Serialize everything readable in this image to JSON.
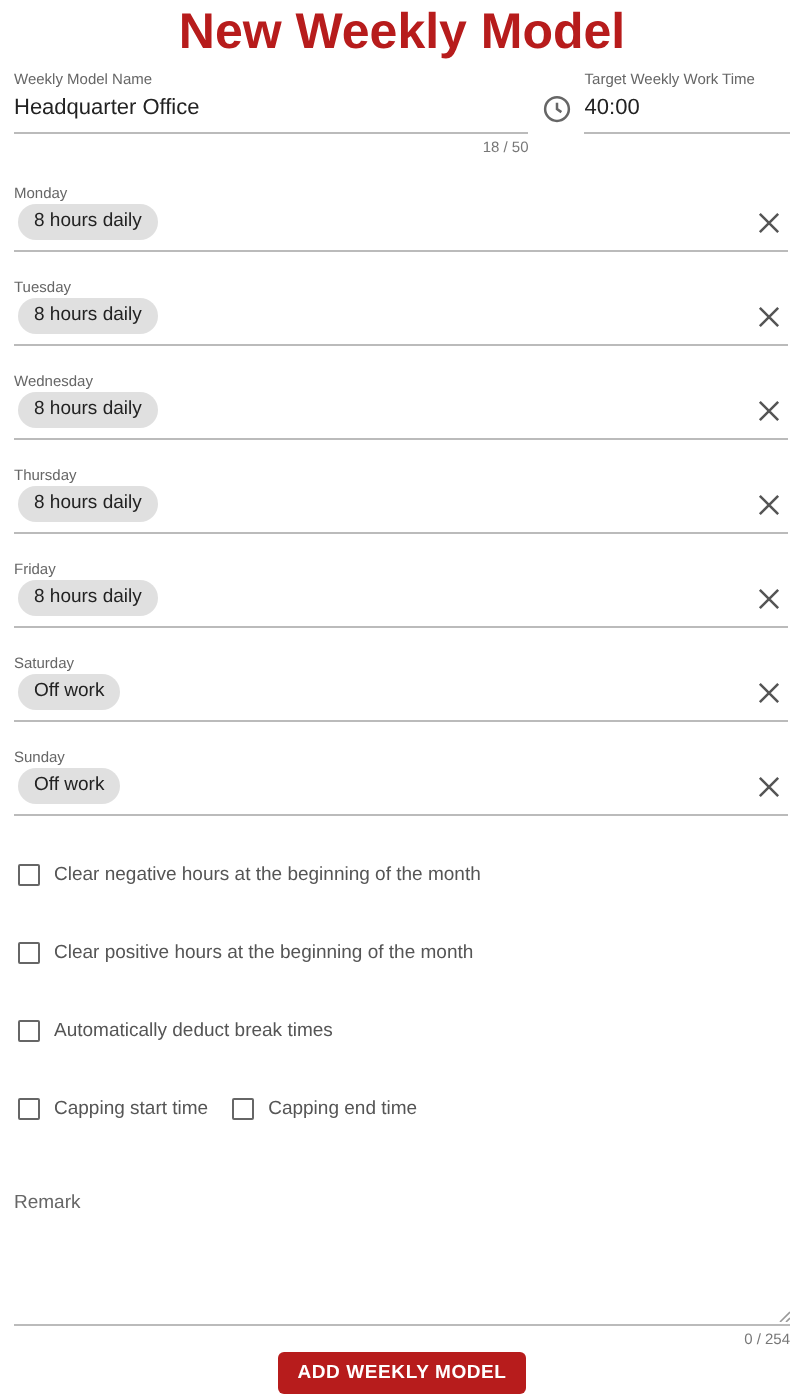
{
  "title": "New Weekly Model",
  "name_field": {
    "label": "Weekly Model Name",
    "value": "Headquarter Office",
    "counter": "18 / 50"
  },
  "target_field": {
    "label": "Target Weekly Work Time",
    "value": "40:00"
  },
  "days": [
    {
      "label": "Monday",
      "chip": "8 hours daily"
    },
    {
      "label": "Tuesday",
      "chip": "8 hours daily"
    },
    {
      "label": "Wednesday",
      "chip": "8 hours daily"
    },
    {
      "label": "Thursday",
      "chip": "8 hours daily"
    },
    {
      "label": "Friday",
      "chip": "8 hours daily"
    },
    {
      "label": "Saturday",
      "chip": "Off work"
    },
    {
      "label": "Sunday",
      "chip": "Off work"
    }
  ],
  "option_rows": [
    [
      {
        "label": "Clear negative hours at the beginning of the month",
        "checked": false
      }
    ],
    [
      {
        "label": "Clear positive hours at the beginning of the month",
        "checked": false
      }
    ],
    [
      {
        "label": "Automatically deduct break times",
        "checked": false
      }
    ],
    [
      {
        "label": "Capping start time",
        "checked": false
      },
      {
        "label": "Capping end time",
        "checked": false
      }
    ]
  ],
  "remark": {
    "label": "Remark",
    "counter": "0 / 254"
  },
  "submit_button": "ADD WEEKLY MODEL"
}
